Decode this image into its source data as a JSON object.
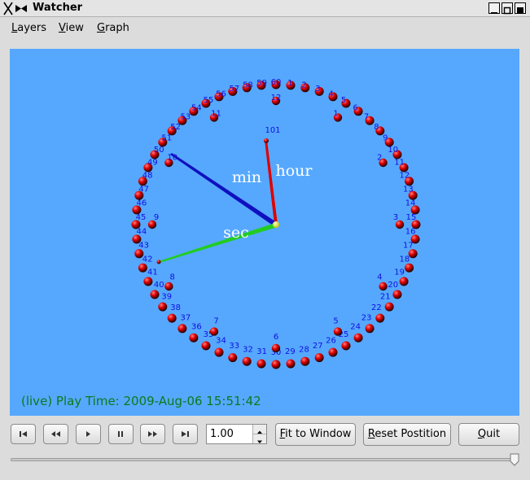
{
  "window": {
    "title": "Watcher",
    "app_icon": "x-bowtie-icon",
    "controls": [
      "minimize-icon",
      "maximize-icon",
      "close-icon"
    ]
  },
  "menu": {
    "layers": {
      "mnemonic": "L",
      "rest": "ayers"
    },
    "view": {
      "mnemonic": "V",
      "rest": "iew"
    },
    "graph": {
      "mnemonic": "G",
      "rest": "raph"
    }
  },
  "canvas": {
    "background": "#56a8ff",
    "outer_ring": {
      "labels": [
        "1",
        "2",
        "3",
        "4",
        "5",
        "6",
        "7",
        "8",
        "9",
        "10",
        "11",
        "12",
        "13",
        "14",
        "15",
        "16",
        "17",
        "18",
        "19",
        "20",
        "21",
        "22",
        "23",
        "24",
        "25",
        "26",
        "27",
        "28",
        "29",
        "30",
        "31",
        "32",
        "33",
        "34",
        "35",
        "36",
        "37",
        "38",
        "39",
        "40",
        "41",
        "42",
        "43",
        "44",
        "45",
        "46",
        "47",
        "48",
        "49",
        "50",
        "51",
        "52",
        "53",
        "54",
        "55",
        "56",
        "57",
        "58",
        "59",
        "60"
      ]
    },
    "inner_ring": {
      "labels": [
        "1",
        "2",
        "3",
        "4",
        "5",
        "6",
        "7",
        "8",
        "9",
        "10",
        "11",
        "12"
      ]
    },
    "marker_label": "101",
    "hand_labels": {
      "hour": "hour",
      "min": "min",
      "sec": "sec"
    },
    "colors": {
      "ball": "#e00000",
      "label": "#1010dd",
      "hour_hand": "#e00000",
      "min_hand": "#1010c0",
      "sec_hand": "#22cc22",
      "hub": "#ffff00"
    },
    "status": "(live) Play Time: 2009-Aug-06 15:51:42"
  },
  "controls": {
    "buttons": [
      "skip-to-start-icon",
      "rewind-icon",
      "play-icon",
      "pause-icon",
      "fast-forward-icon",
      "skip-to-end-icon"
    ],
    "speed_value": "1.00",
    "fit_to_window": {
      "mnemonic": "F",
      "rest": "it to Window"
    },
    "reset_position": {
      "mnemonic": "R",
      "rest": "eset Postition"
    },
    "quit": {
      "mnemonic": "Q",
      "rest": "uit"
    },
    "timeline_position_percent": 100
  }
}
